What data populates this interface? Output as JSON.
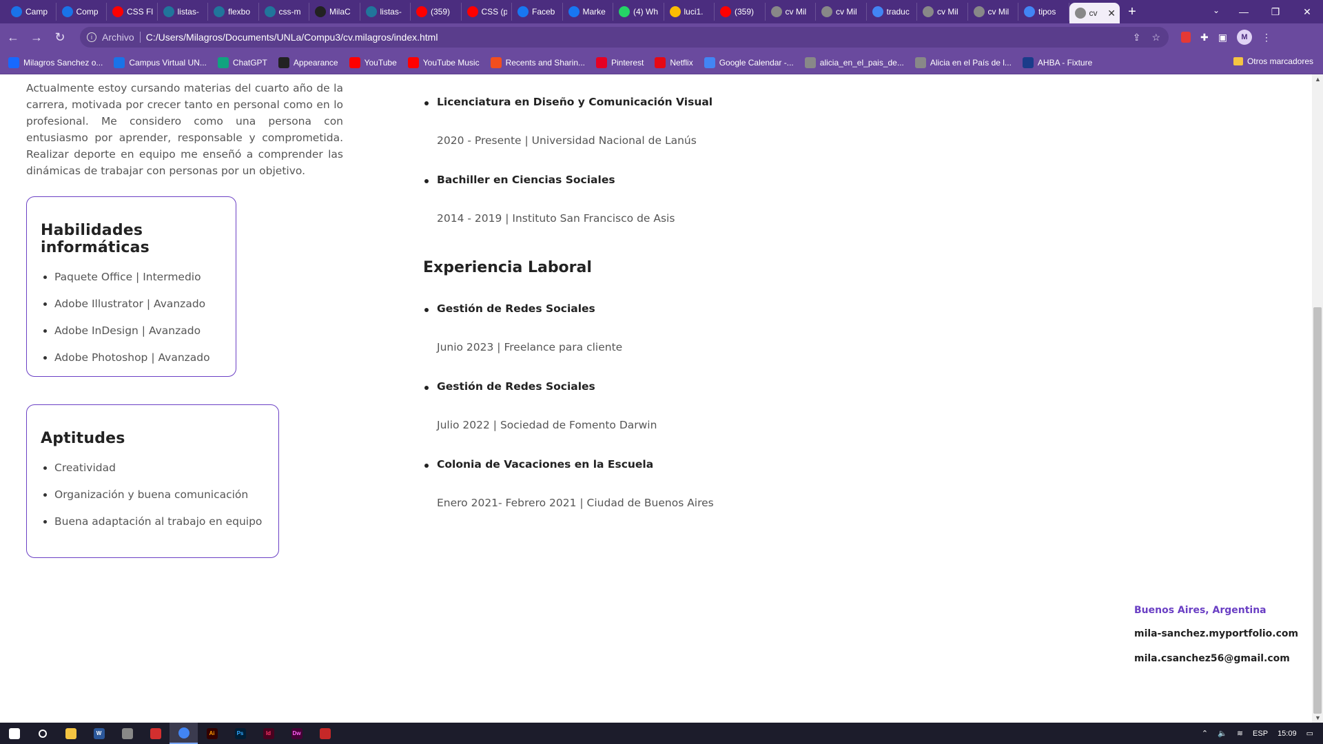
{
  "browser": {
    "tabs": [
      {
        "title": "Camp",
        "icon": "campus-icon",
        "color": "#1a73e8"
      },
      {
        "title": "Comp",
        "icon": "campus-icon",
        "color": "#1a73e8"
      },
      {
        "title": "CSS Fl",
        "icon": "youtube-icon",
        "color": "#ff0000"
      },
      {
        "title": "listas-",
        "icon": "wordpress-icon",
        "color": "#21759b"
      },
      {
        "title": "flexbo",
        "icon": "wordpress-icon",
        "color": "#21759b"
      },
      {
        "title": "css-m",
        "icon": "wordpress-icon",
        "color": "#21759b"
      },
      {
        "title": "MilaC",
        "icon": "github-icon",
        "color": "#222222"
      },
      {
        "title": "listas-",
        "icon": "wordpress-icon",
        "color": "#21759b"
      },
      {
        "title": "(359)",
        "icon": "youtube-icon",
        "color": "#ff0000"
      },
      {
        "title": "CSS (p",
        "icon": "youtube-icon",
        "color": "#ff0000"
      },
      {
        "title": "Faceb",
        "icon": "facebook-icon",
        "color": "#1877f2"
      },
      {
        "title": "Marke",
        "icon": "facebook-icon",
        "color": "#1877f2"
      },
      {
        "title": "(4) Wh",
        "icon": "whatsapp-icon",
        "color": "#25d366"
      },
      {
        "title": "luci1.",
        "icon": "drive-icon",
        "color": "#fbbc04"
      },
      {
        "title": "(359)",
        "icon": "youtube-icon",
        "color": "#ff0000"
      },
      {
        "title": "cv Mil",
        "icon": "globe-icon",
        "color": "#888888"
      },
      {
        "title": "cv Mil",
        "icon": "globe-icon",
        "color": "#888888"
      },
      {
        "title": "traduc",
        "icon": "google-icon",
        "color": "#4285f4"
      },
      {
        "title": "cv Mil",
        "icon": "globe-icon",
        "color": "#888888"
      },
      {
        "title": "cv Mil",
        "icon": "globe-icon",
        "color": "#888888"
      },
      {
        "title": "tipos",
        "icon": "google-icon",
        "color": "#4285f4"
      }
    ],
    "active_tab": {
      "title": "cv",
      "close": "✕"
    },
    "new_tab": "+",
    "address": {
      "scheme": "Archivo",
      "url": "C:/Users/Milagros/Documents/UNLa/Compu3/cv.milagros/index.html"
    },
    "profile_initial": "M",
    "bookmarks": [
      {
        "label": "Milagros Sanchez o...",
        "icon": "behance-icon",
        "color": "#1769ff"
      },
      {
        "label": "Campus Virtual UN...",
        "icon": "campus-icon",
        "color": "#1a73e8"
      },
      {
        "label": "ChatGPT",
        "icon": "chatgpt-icon",
        "color": "#10a37f"
      },
      {
        "label": "Appearance",
        "icon": "github-icon",
        "color": "#222222"
      },
      {
        "label": "YouTube",
        "icon": "youtube-icon",
        "color": "#ff0000"
      },
      {
        "label": "YouTube Music",
        "icon": "youtube-music-icon",
        "color": "#ff0000"
      },
      {
        "label": "Recents and Sharin...",
        "icon": "figma-icon",
        "color": "#f24e1e"
      },
      {
        "label": "Pinterest",
        "icon": "pinterest-icon",
        "color": "#e60023"
      },
      {
        "label": "Netflix",
        "icon": "netflix-icon",
        "color": "#e50914"
      },
      {
        "label": "Google Calendar -...",
        "icon": "calendar-icon",
        "color": "#4285f4"
      },
      {
        "label": "alicia_en_el_pais_de...",
        "icon": "globe-icon",
        "color": "#888888"
      },
      {
        "label": "Alicia en el País de l...",
        "icon": "globe-icon",
        "color": "#888888"
      },
      {
        "label": "AHBA - Fixture",
        "icon": "ahba-icon",
        "color": "#1a3c8a"
      }
    ],
    "other_bookmarks": "Otros marcadores"
  },
  "cv": {
    "intro": "Actualmente estoy cursando materias del cuarto año de la carrera, motivada por crecer tanto en personal como en lo profesional. Me considero como una persona con entusiasmo por aprender, responsable y comprometida. Realizar deporte en equipo me enseñó a comprender las dinámicas de trabajar con personas por un objetivo.",
    "skills": {
      "title": "Habilidades informáticas",
      "items": [
        "Paquete Office | Intermedio",
        "Adobe Illustrator | Avanzado",
        "Adobe InDesign | Avanzado",
        "Adobe Photoshop | Avanzado"
      ]
    },
    "aptitudes": {
      "title": "Aptitudes",
      "items": [
        "Creatividad",
        "Organización y buena comunicación",
        "Buena adaptación al trabajo en equipo"
      ]
    },
    "education": [
      {
        "title": "Licenciatura en Diseño y Comunicación Visual",
        "detail": "2020 - Presente | Universidad Nacional de Lanús"
      },
      {
        "title": "Bachiller en Ciencias Sociales",
        "detail": "2014 - 2019 | Instituto San Francisco de Asis"
      }
    ],
    "experience_title": "Experiencia Laboral",
    "experience": [
      {
        "title": "Gestión de Redes Sociales",
        "detail": "Junio 2023 | Freelance para cliente"
      },
      {
        "title": "Gestión de Redes Sociales",
        "detail": "Julio 2022 | Sociedad de Fomento Darwin"
      },
      {
        "title": "Colonia de Vacaciones en la Escuela",
        "detail": "Enero 2021- Febrero 2021 | Ciudad de Buenos Aires"
      }
    ],
    "footer": {
      "location": "Buenos Aires, Argentina",
      "portfolio": "mila-sanchez.myportfolio.com",
      "email": "mila.csanchez56@gmail.com"
    },
    "accent_color": "#6a3fc4"
  },
  "taskbar": {
    "apps": [
      {
        "icon": "windows-start-icon",
        "label": ""
      },
      {
        "icon": "search-icon",
        "label": ""
      },
      {
        "icon": "file-explorer-icon",
        "label": ""
      },
      {
        "icon": "word-icon",
        "label": "W"
      },
      {
        "icon": "app-icon",
        "label": ""
      },
      {
        "icon": "acrobat-icon",
        "label": ""
      },
      {
        "icon": "chrome-icon",
        "label": ""
      },
      {
        "icon": "illustrator-icon",
        "label": "Ai"
      },
      {
        "icon": "photoshop-icon",
        "label": "Ps"
      },
      {
        "icon": "indesign-icon",
        "label": "Id"
      },
      {
        "icon": "dreamweaver-icon",
        "label": "Dw"
      },
      {
        "icon": "app-icon",
        "label": ""
      }
    ],
    "language": "ESP",
    "time": "15:09"
  }
}
